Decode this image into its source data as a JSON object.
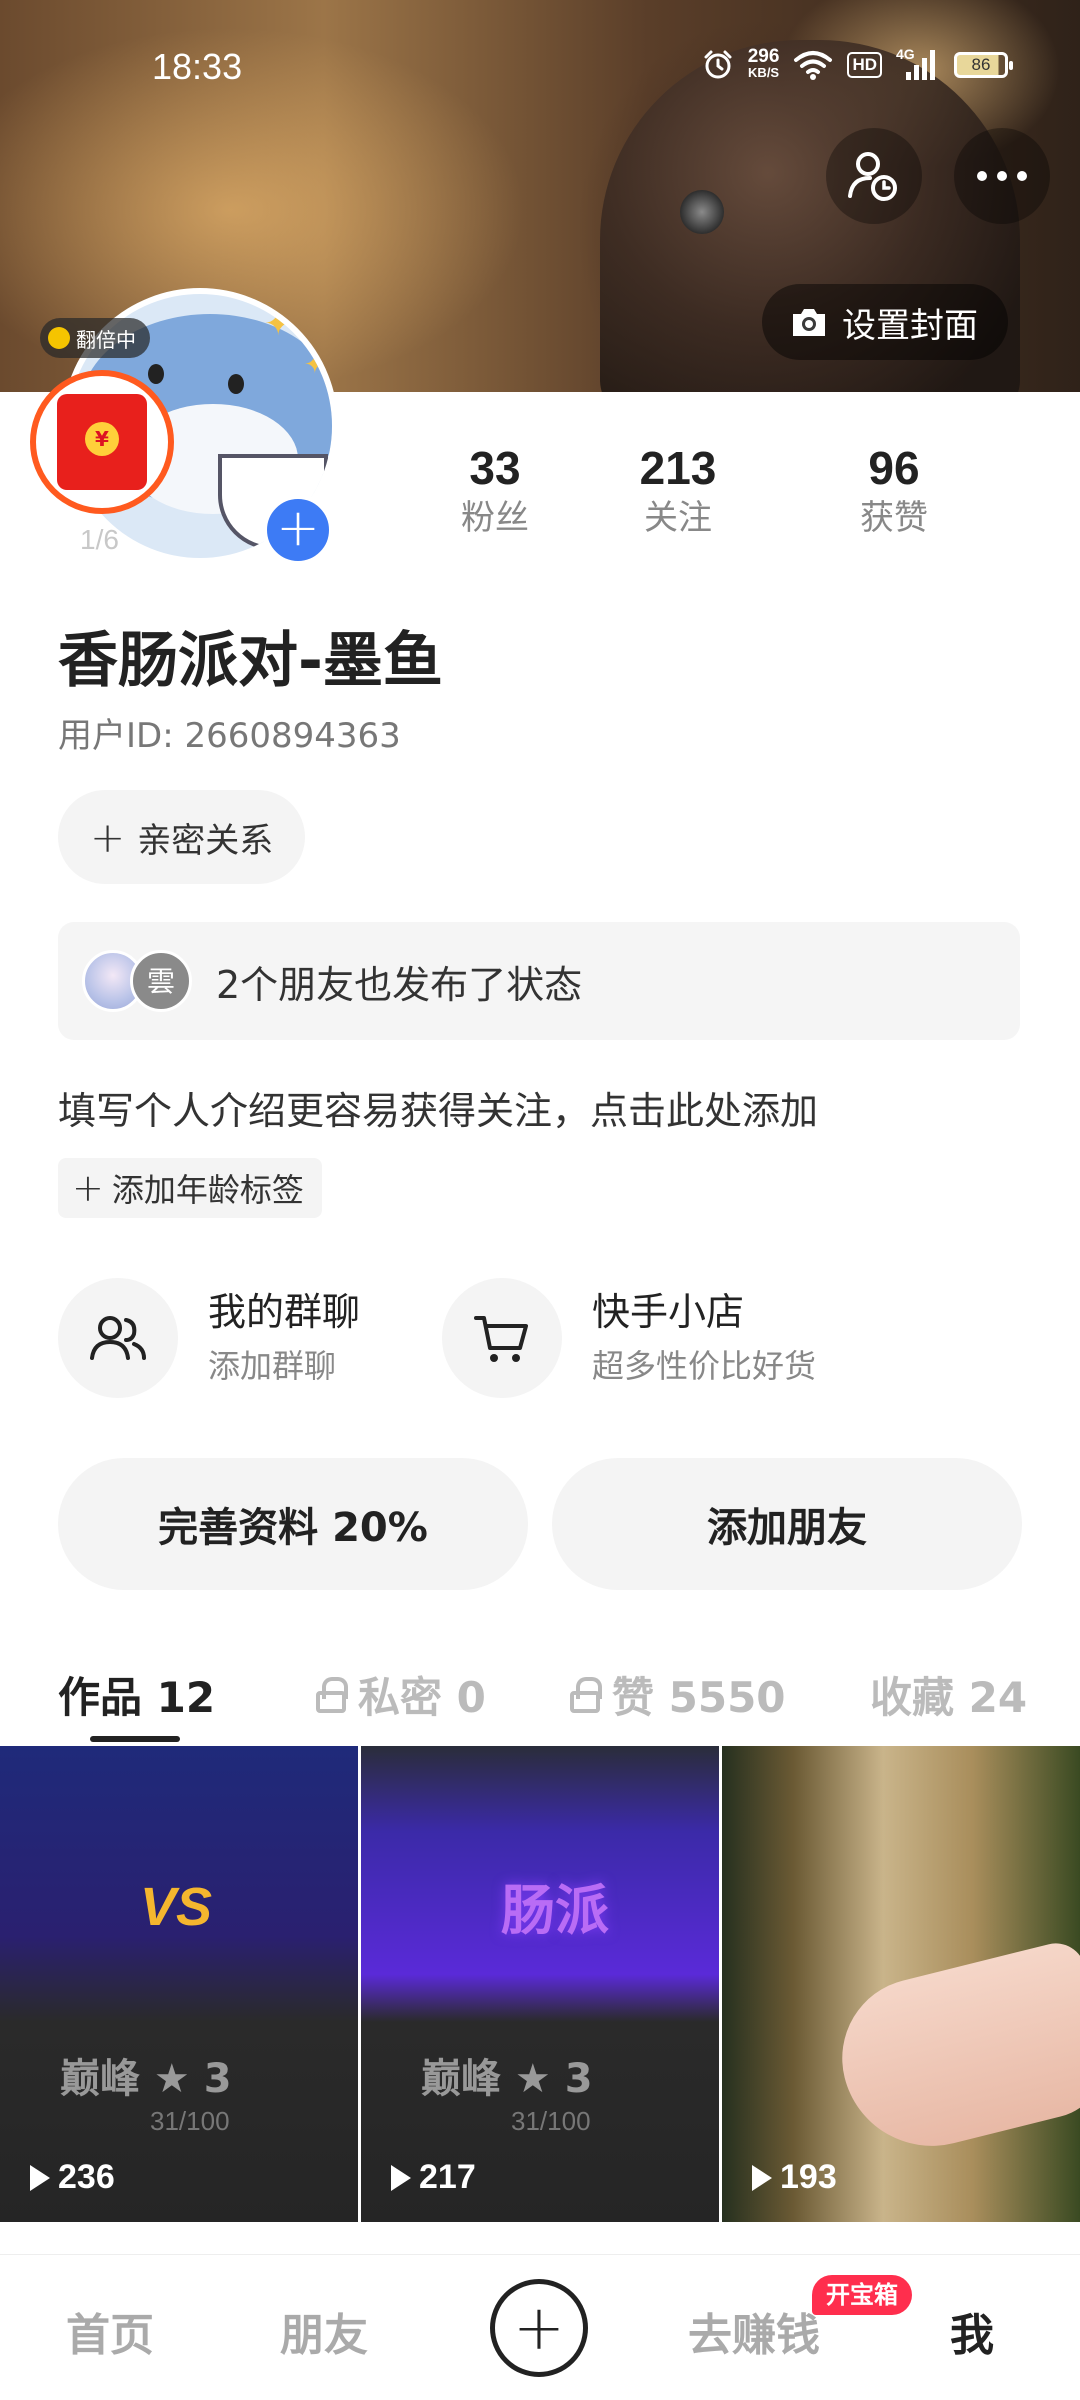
{
  "status_bar": {
    "time": "18:33",
    "net_speed_value": "296",
    "net_speed_unit": "KB/S",
    "hd_label": "HD",
    "signal_label": "4G",
    "battery": "86"
  },
  "cover": {
    "set_cover_label": "设置封面",
    "visitors_icon": "visitor-clock-icon",
    "more_icon": "more-dots-icon"
  },
  "avatar": {
    "double_badge": "翻倍中",
    "redpacket_seal": "¥",
    "redpacket_count": "1/6",
    "add_icon": "plus-icon"
  },
  "stats": [
    {
      "value": "33",
      "label": "粉丝"
    },
    {
      "value": "213",
      "label": "关注"
    },
    {
      "value": "96",
      "label": "获赞"
    }
  ],
  "profile": {
    "name": "香肠派对-墨鱼",
    "user_id": "用户ID: 2660894363",
    "intimate_label": "亲密关系",
    "friends_status": "2个朋友也发布了状态",
    "friend_b_initial": "雲",
    "bio_prompt": "填写个人介绍更容易获得关注，点击此处添加",
    "age_tag_label": "添加年龄标签"
  },
  "shortcuts": {
    "group": {
      "title": "我的群聊",
      "subtitle": "添加群聊"
    },
    "shop": {
      "title": "快手小店",
      "subtitle": "超多性价比好货"
    }
  },
  "actions": {
    "complete_profile": "完善资料 20%",
    "add_friend": "添加朋友"
  },
  "tabs": {
    "works": "作品 12",
    "private": "私密 0",
    "likes": "赞 5550",
    "favorites": "收藏 24"
  },
  "videos": [
    {
      "plays": "236",
      "overlay_vs": "VS",
      "overlay_peak": "巅峰 ★ 3",
      "overlay_score": "31/100"
    },
    {
      "plays": "217",
      "overlay_logo": "肠派",
      "overlay_peak": "巅峰 ★ 3",
      "overlay_score": "31/100"
    },
    {
      "plays": "193"
    }
  ],
  "bottom_nav": {
    "home": "首页",
    "friends": "朋友",
    "earn": "去赚钱",
    "earn_badge": "开宝箱",
    "me": "我"
  },
  "colors": {
    "accent_blue": "#3d7bf5",
    "badge_red": "#ff2e4d",
    "redpacket_ring": "#ff5a1f"
  }
}
